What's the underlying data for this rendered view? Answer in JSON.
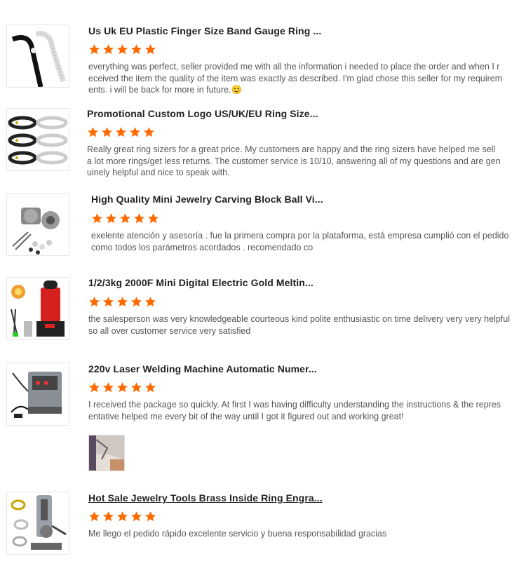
{
  "colors": {
    "star": "#ff6a00",
    "title": "#222222",
    "text": "#555555"
  },
  "reviews": [
    {
      "product": "Us Uk EU Plastic Finger Size Band Gauge Ring ...",
      "rating": 5,
      "text": "everything was perfect, seller provided me with all the information i needed to place the order and when I received the item the quality of the item was exactly as described. I'm glad chose this seller for my requirements. i will be back for more in future.",
      "emoji": "😊"
    },
    {
      "product": "Promotional Custom Logo US/UK/EU Ring Size...",
      "rating": 5,
      "text": "Really great ring sizers for a great price.  My customers are happy and the ring sizers have helped me sell a lot more rings/get less returns.  The customer service is 10/10, answering all of my questions and are genuinely helpful and nice to speak with."
    },
    {
      "product": "High Quality Mini Jewelry Carving Block Ball Vi...",
      "rating": 5,
      "text": "exelente atención y asesoría . fue la primera compra por la plataforma, está empresa cumplió con el pedido como todos los parámetros acordados . recomendado co"
    },
    {
      "product": "1/2/3kg 2000F Mini Digital Electric Gold Meltin...",
      "rating": 5,
      "text": "the salesperson was very knowledgeable courteous kind polite enthusiastic on time delivery very very helpful so all over customer service very satisfied"
    },
    {
      "product": "220v Laser Welding Machine Automatic Numer...",
      "rating": 5,
      "text": "I received the package so quickly. At first I was having difficulty understanding the instructions & the representative helped me every bit of the way until I got it figured out and working great!"
    },
    {
      "product": "Hot Sale Jewelry Tools Brass Inside Ring Engra...",
      "rating": 5,
      "text": "Me llego el pedido rápido excelente servicio y buena responsabilidad gracias"
    }
  ]
}
